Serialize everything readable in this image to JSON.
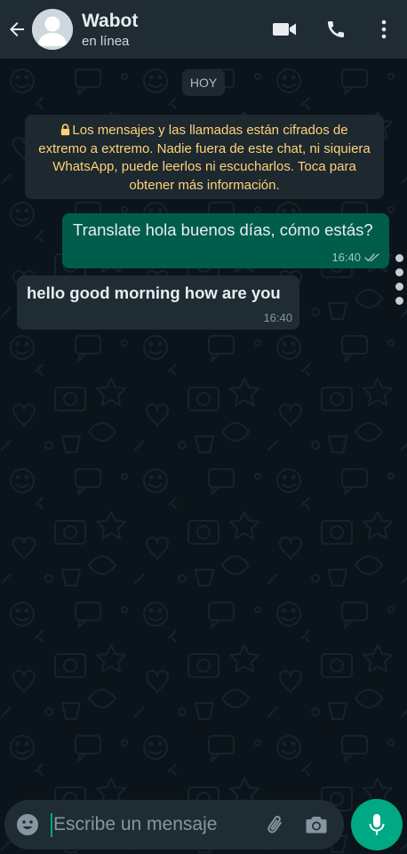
{
  "header": {
    "back_icon": "arrow-left-icon",
    "contact_name": "Wabot",
    "contact_status": "en línea",
    "actions": [
      "video-call-icon",
      "phone-icon",
      "more-vert-icon"
    ]
  },
  "chat": {
    "date_chip": "HOY",
    "encryption_notice": "Los mensajes y las llamadas están cifrados de extremo a extremo. Nadie fuera de este chat, ni siquiera WhatsApp, puede leerlos ni escucharlos. Toca para obtener más información.",
    "messages": [
      {
        "direction": "outgoing",
        "text": "Translate hola buenos días, cómo estás?",
        "time": "16:40",
        "status": "read-double-check"
      },
      {
        "direction": "incoming",
        "text": "hello good morning how are you",
        "time": "16:40"
      }
    ]
  },
  "composer": {
    "placeholder": "Escribe un mensaje",
    "emoji_icon": "emoji-icon",
    "attach_icon": "paperclip-icon",
    "camera_icon": "camera-icon",
    "mic_icon": "mic-icon"
  },
  "colors": {
    "header_bg": "#1f2c34",
    "chat_bg": "#0b141a",
    "outgoing_bubble": "#005c4b",
    "incoming_bubble": "#1f2c34",
    "notice_text": "#ffd279",
    "accent": "#00a884"
  }
}
